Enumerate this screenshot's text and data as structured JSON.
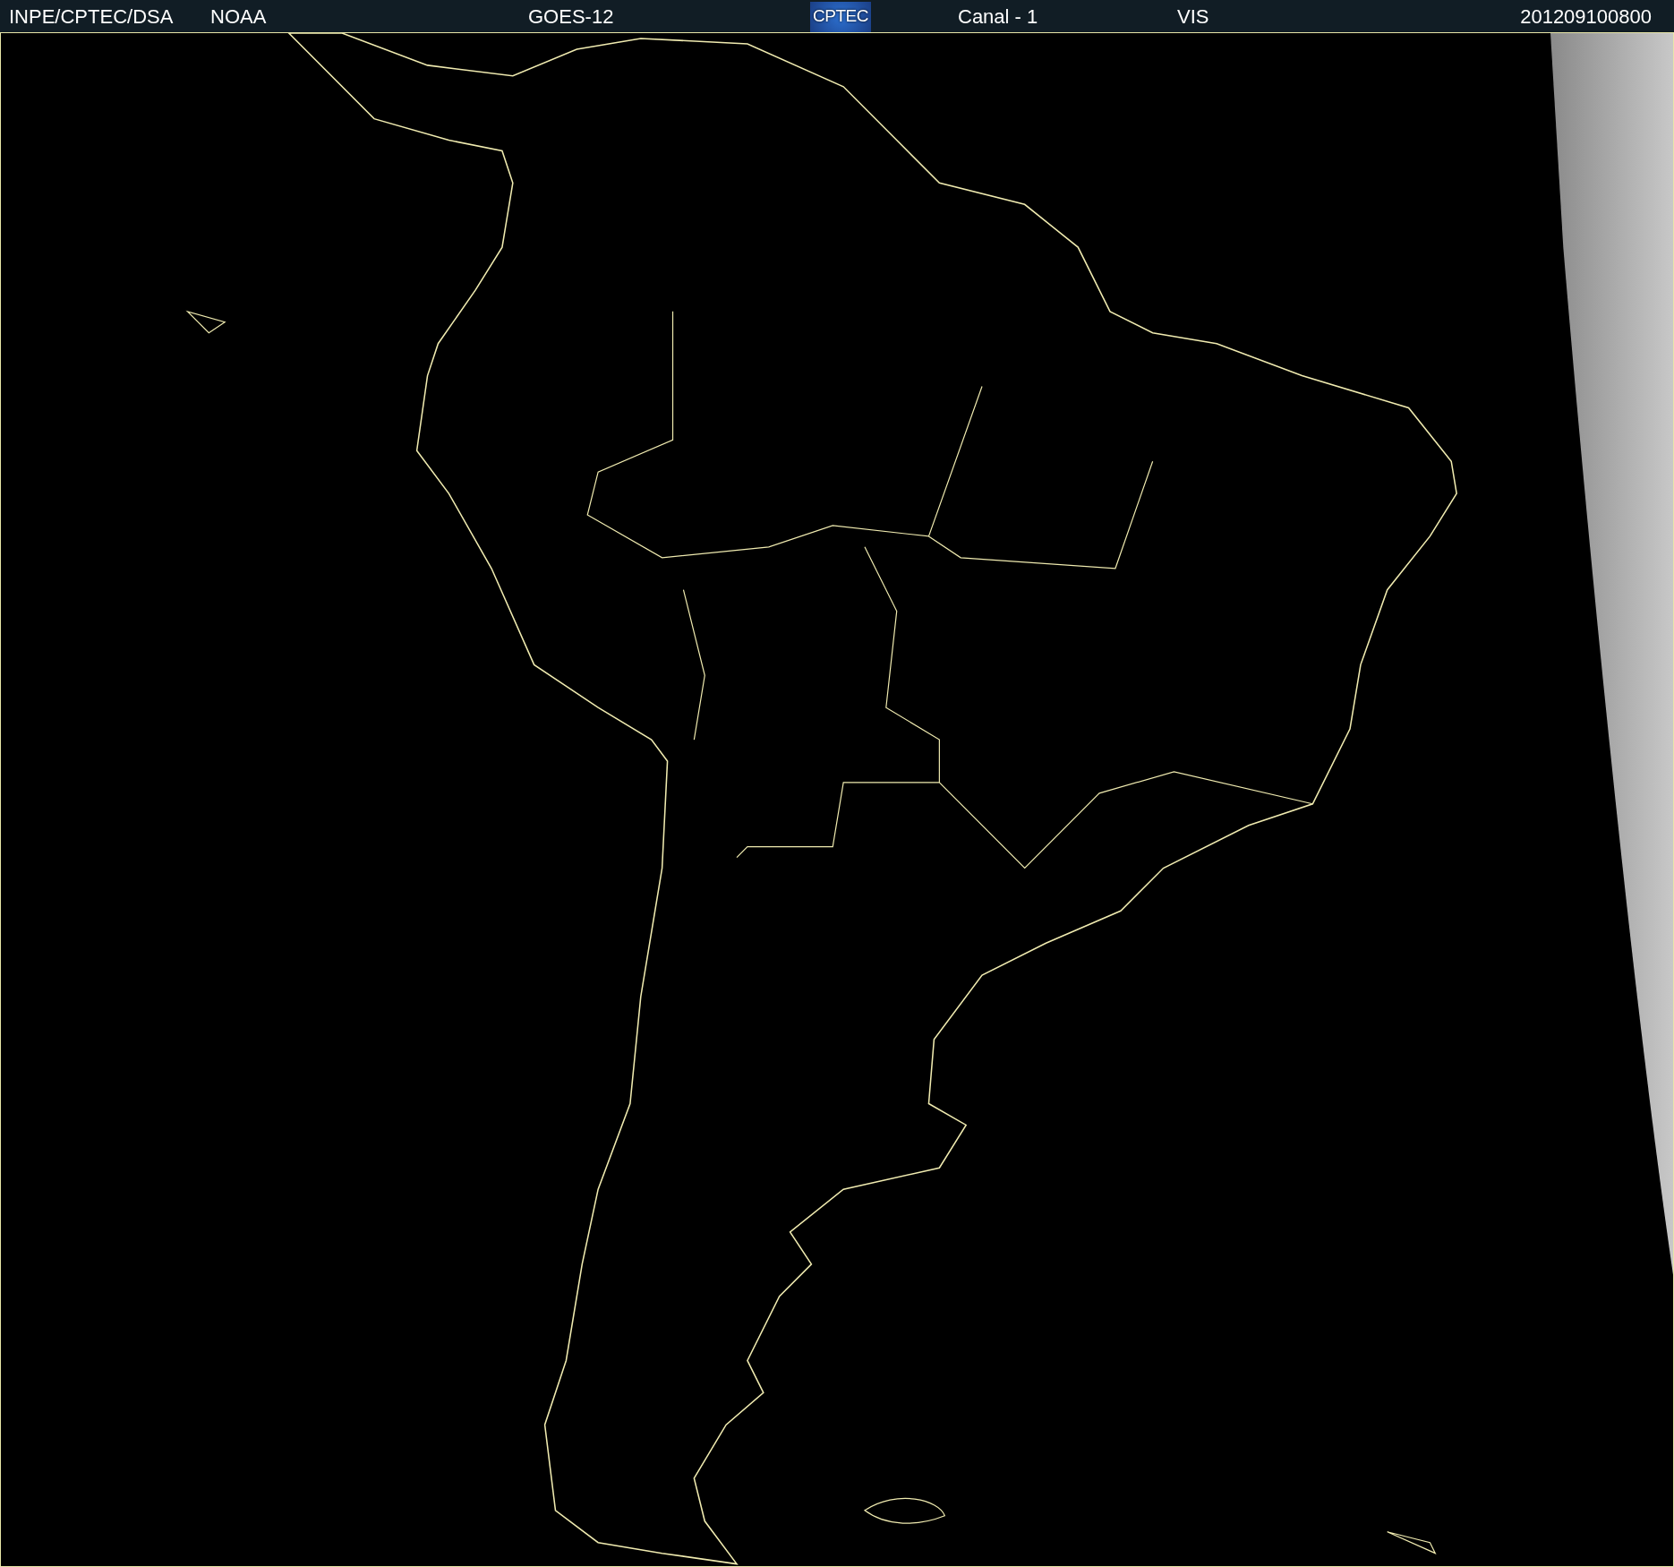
{
  "header": {
    "items": [
      {
        "kind": "text",
        "text": "INPE/CPTEC/DSA"
      },
      {
        "kind": "text",
        "text": "NOAA"
      },
      {
        "kind": "text",
        "text": "GOES-12"
      },
      {
        "kind": "logo",
        "text": "CPTEC"
      },
      {
        "kind": "text",
        "text": "Canal - 1"
      },
      {
        "kind": "text",
        "text": "VIS"
      },
      {
        "kind": "text",
        "text": "201209100800"
      }
    ]
  }
}
